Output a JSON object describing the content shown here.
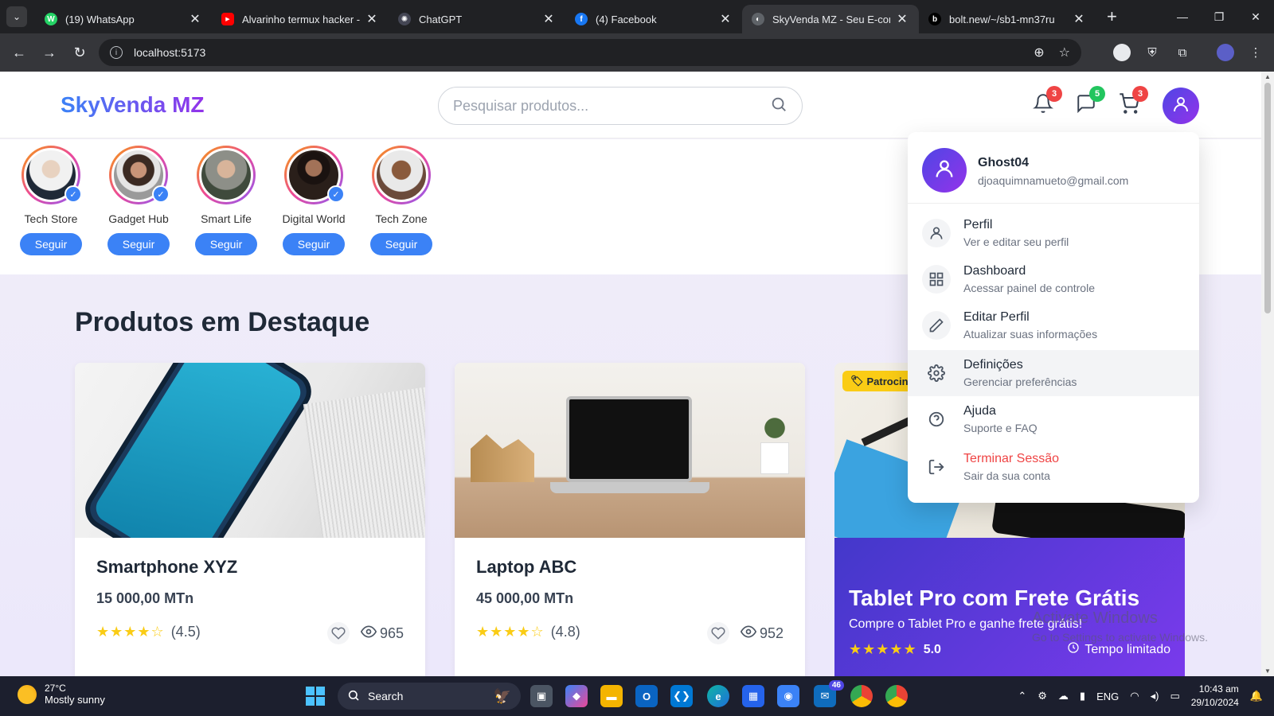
{
  "browser": {
    "tabs": [
      {
        "title": "(19) WhatsApp",
        "fav_color": "#25d366",
        "fav": "W"
      },
      {
        "title": "Alvarinho termux hacker -",
        "fav_color": "#ff0000",
        "fav": "▶"
      },
      {
        "title": "ChatGPT",
        "fav_color": "#444654",
        "fav": "✺"
      },
      {
        "title": "(4) Facebook",
        "fav_color": "#1877f2",
        "fav": "f"
      },
      {
        "title": "SkyVenda MZ - Seu E-comm",
        "fav_color": "#5f6368",
        "fav": "◐"
      },
      {
        "title": "bolt.new/~/sb1-mn37ru",
        "fav_color": "#000000",
        "fav": "b"
      }
    ],
    "url": "localhost:5173"
  },
  "header": {
    "logo": "SkyVenda MZ",
    "search_placeholder": "Pesquisar produtos...",
    "notifications_count": "3",
    "messages_count": "5",
    "cart_count": "3"
  },
  "stories": [
    {
      "name": "Tech Store",
      "verified": true,
      "follow": "Seguir"
    },
    {
      "name": "Gadget Hub",
      "verified": true,
      "follow": "Seguir"
    },
    {
      "name": "Smart Life",
      "verified": false,
      "follow": "Seguir"
    },
    {
      "name": "Digital World",
      "verified": true,
      "follow": "Seguir"
    },
    {
      "name": "Tech Zone",
      "verified": false,
      "follow": "Seguir"
    }
  ],
  "section_title": "Produtos em Destaque",
  "products": [
    {
      "name": "Smartphone XYZ",
      "price": "15 000,00 MTn",
      "rating": "(4.5)",
      "stars": "★★★★☆",
      "views": "965"
    },
    {
      "name": "Laptop ABC",
      "price": "45 000,00 MTn",
      "rating": "(4.8)",
      "stars": "★★★★☆",
      "views": "952"
    }
  ],
  "promo": {
    "sponsor": "Patrocin",
    "title": "Tablet Pro com Frete Grátis",
    "subtitle": "Compre o Tablet Pro e ganhe frete grátis!",
    "stars": "★★★★★",
    "rating": "5.0",
    "time": "Tempo limitado"
  },
  "windows_watermark": {
    "line1": "Activate Windows",
    "line2": "Go to Settings to activate Windows."
  },
  "user_menu": {
    "username": "Ghost04",
    "email": "djoaquimnamueto@gmail.com",
    "items": [
      {
        "label": "Perfil",
        "desc": "Ver e editar seu perfil",
        "icon": "user-icon"
      },
      {
        "label": "Dashboard",
        "desc": "Acessar painel de controle",
        "icon": "grid-icon"
      },
      {
        "label": "Editar Perfil",
        "desc": "Atualizar suas informações",
        "icon": "pencil-icon"
      },
      {
        "label": "Definições",
        "desc": "Gerenciar preferências",
        "icon": "gear-icon"
      },
      {
        "label": "Ajuda",
        "desc": "Suporte e FAQ",
        "icon": "help-icon"
      },
      {
        "label": "Terminar Sessão",
        "desc": "Sair da sua conta",
        "icon": "logout-icon"
      }
    ]
  },
  "taskbar": {
    "temperature": "27°C",
    "weather": "Mostly sunny",
    "search": "Search",
    "mail_badge": "46",
    "lang": "ENG",
    "time": "10:43 am",
    "date": "29/10/2024"
  },
  "colors": {
    "accent": "#3b82f6",
    "brand_from": "#3b82f6",
    "brand_to": "#9333ea",
    "danger": "#ef4444"
  }
}
